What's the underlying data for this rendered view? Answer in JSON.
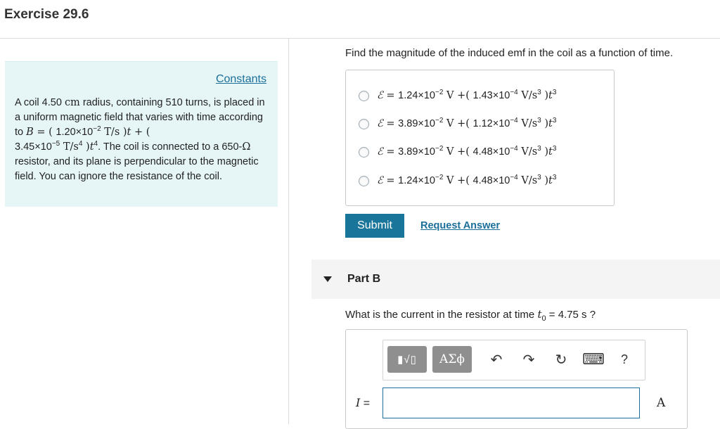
{
  "header": {
    "title": "Exercise 29.6"
  },
  "problem": {
    "constants_label": "Constants",
    "text_1": "A coil 4.50 ",
    "cm": "cm",
    "text_2": " radius, containing 510 turns, is placed in a uniform magnetic field that varies with time according to ",
    "B": "B",
    "eq": " = ( ",
    "coef1": "1.20×10",
    "exp1": "−2",
    "unit1": " T/s ",
    "t": "t",
    "plus": " + (",
    "coef2": "3.45×10",
    "exp2": "−5",
    "unit2": " T/s",
    "unit2_exp": "4",
    "paren": " )",
    "t2": "t",
    "t2_exp": "4",
    "text_3": ". The coil is connected to a 650-",
    "ohm": "Ω",
    "text_4": " resistor, and its plane is perpendicular to the magnetic field. You can ignore the resistance of the coil."
  },
  "part_a": {
    "question": "Find the magnitude of the induced emf in the coil as a function of time.",
    "options": [
      {
        "c1": "1.24×10",
        "e1": "−2",
        "c2": "1.43×10",
        "e2": "−4"
      },
      {
        "c1": "3.89×10",
        "e1": "−2",
        "c2": "1.12×10",
        "e2": "−4"
      },
      {
        "c1": "3.89×10",
        "e1": "−2",
        "c2": "4.48×10",
        "e2": "−4"
      },
      {
        "c1": "1.24×10",
        "e1": "−2",
        "c2": "4.48×10",
        "e2": "−4"
      }
    ],
    "emf_symbol": "ℰ",
    "volt": " V ",
    "rate_unit": " V/s",
    "rate_exp": "3",
    "t_var": "t",
    "t_exp": "3",
    "submit_label": "Submit",
    "request_label": "Request Answer"
  },
  "part_b": {
    "label": "Part B",
    "question_pre": "What is the current in the resistor at time ",
    "t0": "t",
    "t0_sub": "0",
    "question_post": " = 4.75 s ?",
    "toolbar": {
      "templates_label": "▮√▯",
      "symbols_label": "ΑΣϕ",
      "undo_icon": "↶",
      "redo_icon": "↷",
      "reset_icon": "↻",
      "keyboard_icon": "⌨",
      "help_label": "?"
    },
    "input_label": "I",
    "input_eq": " =",
    "input_value": "",
    "unit": "A"
  }
}
